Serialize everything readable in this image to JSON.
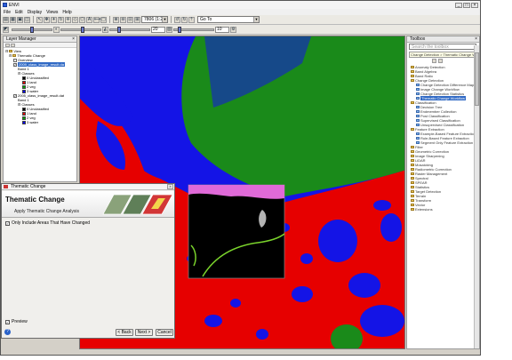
{
  "app": {
    "title": "ENVI"
  },
  "menu": [
    "File",
    "Edit",
    "Display",
    "Views",
    "Help"
  ],
  "toolbar": {
    "zoom_value": "7806 (1:2)",
    "goto_placeholder": "Go To",
    "stretch_value_1": "20",
    "stretch_value_2": "10"
  },
  "layer_manager": {
    "title": "Layer Manager",
    "items": {
      "view": "View",
      "thematic": "Thematic Change",
      "overview": "Overview",
      "layer1": "2009_class_image_result.da",
      "band1a": "Band 1",
      "classes_a": "Classes",
      "layer2": "2005_class_image_result.dat",
      "band1b": "Band 1",
      "classes_b": "Classes"
    },
    "classes_a": [
      {
        "label": "0  Unclassified",
        "color": "#000000"
      },
      {
        "label": "1  land",
        "color": "#e60000"
      },
      {
        "label": "2  veg",
        "color": "#00aa00"
      },
      {
        "label": "3  water",
        "color": "#0000ff"
      }
    ],
    "classes_b": [
      {
        "label": "0  Unclassified",
        "color": "#000000"
      },
      {
        "label": "1  land",
        "color": "#e60000"
      },
      {
        "label": "2  veg",
        "color": "#00aa00"
      },
      {
        "label": "3  water",
        "color": "#0000ff"
      }
    ]
  },
  "toolbox": {
    "title": "Toolbox",
    "search_placeholder": "Search the toolbox",
    "tooltip": "Change Detection > Thematic Change Workflow",
    "items": [
      "Anomaly Detection",
      "Band Algebra",
      "Band Ratio",
      "Change Detection",
      "Change Detection Difference Map",
      "Image Change Workflow",
      "Change Detection Statistics",
      "Thematic Change Workflow",
      "Classification",
      "Decision Tree",
      "Endmember Collection",
      "Post Classification",
      "Supervised Classification",
      "Unsupervised Classification",
      "Feature Extraction",
      "Example-Based Feature Extraction",
      "Rule-Based Feature Extraction",
      "Segment Only Feature Extraction",
      "Filter",
      "Geometric Correction",
      "Image Sharpening",
      "LiDAR",
      "Mosaicking",
      "Radiometric Correction",
      "Raster Management",
      "Spectral",
      "SPEAR",
      "Statistics",
      "Target Detection",
      "Terrain",
      "Transform",
      "Vector",
      "Extensions"
    ],
    "selected_index": 7
  },
  "dialog": {
    "window_title": "Thematic Change",
    "heading": "Thematic Change",
    "subheading": "Apply Thematic Change Analysis",
    "only_changed_label": "Only Include Areas That Have Changed",
    "preview_label": "Preview",
    "back_label": "< Back",
    "next_label": "Next >",
    "cancel_label": "Cancel",
    "help_label": "?"
  },
  "colors": {
    "land": "#e60000",
    "veg": "#1a8a1a",
    "water": "#1414e6",
    "unclassified": "#000000",
    "selection": "#316ac5"
  }
}
